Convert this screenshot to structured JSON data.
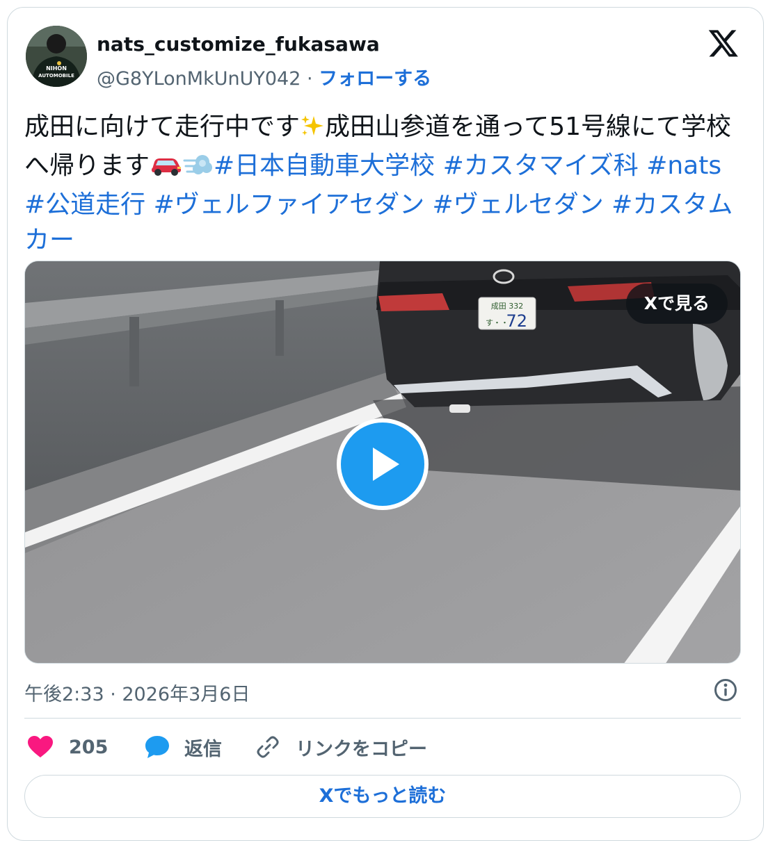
{
  "author": {
    "display_name": "nats_customize_fukasawa",
    "handle": "@G8YLonMkUnUY042",
    "separator": "·",
    "follow_label": "フォローする",
    "avatar_badge_text": "NIHON AUTOMOBILE"
  },
  "brand": {
    "logo_icon": "x-logo-icon"
  },
  "tweet": {
    "text_part1": "成田に向けて走行中です",
    "sparkle_emoji": "✨",
    "text_part2": "成田山参道を通って51号線にて学校へ帰ります",
    "car_emoji": "🚗",
    "dash_emoji": "💨",
    "hashtags": [
      "#日本自動車大学校",
      "#カスタマイズ科",
      "#nats",
      "#公道走行",
      "#ヴェルファイアセダン",
      "#ヴェルセダン",
      "#カスタムカー"
    ]
  },
  "media": {
    "view_on_x_label": "Xで見る",
    "plate_top": "成田 332",
    "plate_number": "72",
    "plate_kana": "す・・"
  },
  "timestamp": "午後2:33 · 2026年3月6日",
  "actions": {
    "like_count": "205",
    "reply_label": "返信",
    "copy_link_label": "リンクをコピー"
  },
  "read_more_label": "Xでもっと読む",
  "colors": {
    "link_blue": "#1d6fd8",
    "like_pink": "#f91880",
    "play_blue": "#1d9bf0",
    "border": "#cfd9de",
    "muted": "#536471"
  }
}
